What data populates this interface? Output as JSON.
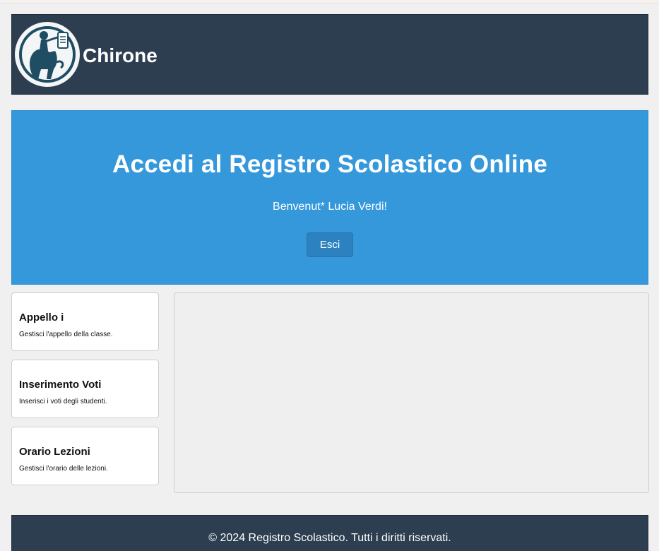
{
  "header": {
    "brand": "Chirone",
    "logo_icon": "centaur-logo-icon"
  },
  "hero": {
    "title": "Accedi al Registro Scolastico Online",
    "welcome": "Benvenut* Lucia Verdi!",
    "logout_label": "Esci"
  },
  "sidebar": {
    "cards": [
      {
        "title": "Appello i",
        "desc": "Gestisci l'appello della classe."
      },
      {
        "title": "Inserimento Voti",
        "desc": "Inserisci i voti degli studenti."
      },
      {
        "title": "Orario Lezioni",
        "desc": "Gestisci l'orario delle lezioni."
      }
    ]
  },
  "footer": {
    "copyright": "© 2024 Registro Scolastico. Tutti i diritti riservati."
  },
  "colors": {
    "header_bg": "#2c3e50",
    "hero_bg": "#3498db",
    "button_bg": "#2c82c0",
    "page_bg": "#f0f0f0"
  }
}
